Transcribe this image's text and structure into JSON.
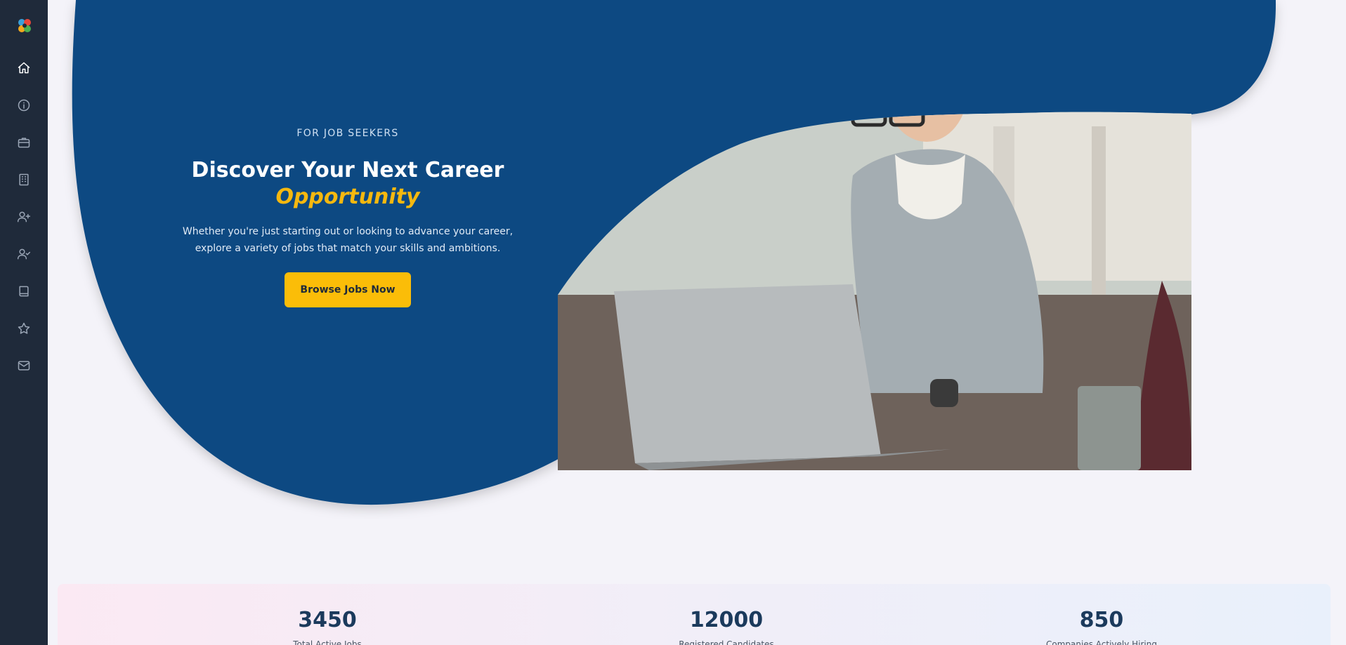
{
  "sidebar": {
    "logo": "flower-logo",
    "items": [
      {
        "icon": "home-icon",
        "active": true
      },
      {
        "icon": "info-icon"
      },
      {
        "icon": "briefcase-icon"
      },
      {
        "icon": "building-icon"
      },
      {
        "icon": "user-plus-icon"
      },
      {
        "icon": "user-check-icon"
      },
      {
        "icon": "book-icon"
      },
      {
        "icon": "star-icon"
      },
      {
        "icon": "mail-icon"
      }
    ]
  },
  "hero": {
    "eyebrow": "FOR JOB SEEKERS",
    "title": "Discover Your Next Career",
    "title_accent": "Opportunity",
    "description": "Whether you're just starting out or looking to advance your career, explore a variety of jobs that match your skills and ambitions.",
    "cta_label": "Browse Jobs Now"
  },
  "stats": [
    {
      "value": "3450",
      "label": "Total Active Jobs"
    },
    {
      "value": "12000",
      "label": "Registered Candidates"
    },
    {
      "value": "850",
      "label": "Companies Actively Hiring"
    }
  ],
  "colors": {
    "sidebar": "#1f2a3a",
    "hero_blue": "#0e4a82",
    "accent_yellow": "#fbbd08",
    "page_bg": "#f4f3f9"
  }
}
